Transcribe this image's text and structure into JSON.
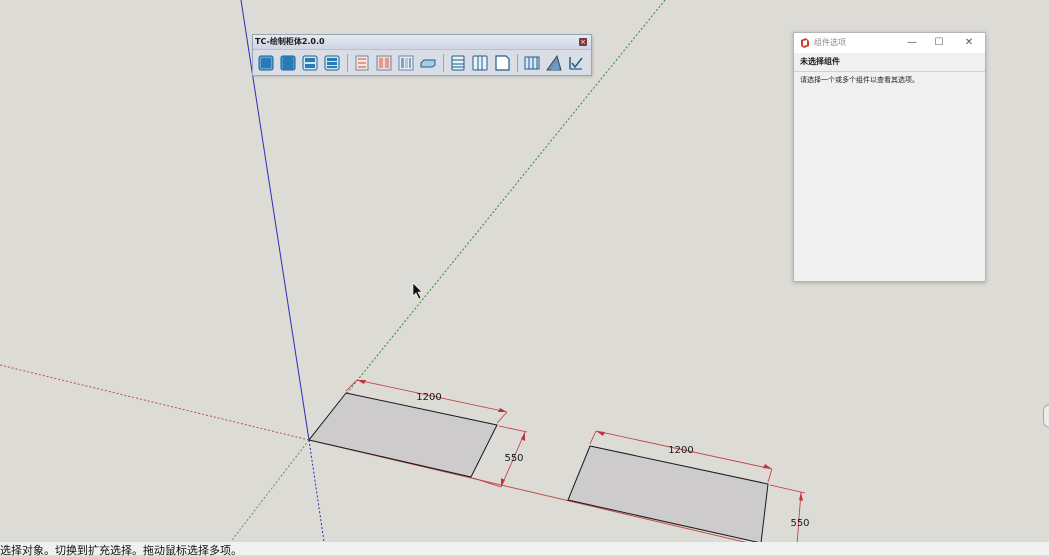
{
  "toolbar": {
    "title": "TC-绘制柜体2.0.0",
    "close_glyph": "×",
    "icons": [
      "cabinet-front-icon",
      "cabinet-box-icon",
      "cabinet-shelf-icon",
      "cabinet-drawer-icon",
      "panel-left-icon",
      "panel-door-icon",
      "panel-side-icon",
      "panel-flat-icon",
      "stack-boards-icon",
      "double-door-icon",
      "cabinet-corner-icon",
      "grid-panel-icon",
      "wedge-icon",
      "check-tool-icon"
    ]
  },
  "dialog": {
    "title": "组件选项",
    "section_title": "未选择组件",
    "message": "请选择一个或多个组件以查看其选项。",
    "minimize": "—",
    "maximize": "☐",
    "close": "✕"
  },
  "dimensions": {
    "left_width": "1200",
    "left_depth": "550",
    "right_width": "1200",
    "right_depth": "550"
  },
  "statusbar": {
    "text": "选择对象。切换到扩充选择。拖动鼠标选择多项。"
  },
  "colors": {
    "viewport_bg": "#dcdbd6",
    "dimension_red": "#c0343d",
    "axis_blue": "#2d2db8",
    "axis_green": "#2f8c2f",
    "axis_red": "#c24a4a",
    "face_fill": "#cdcbcc"
  }
}
